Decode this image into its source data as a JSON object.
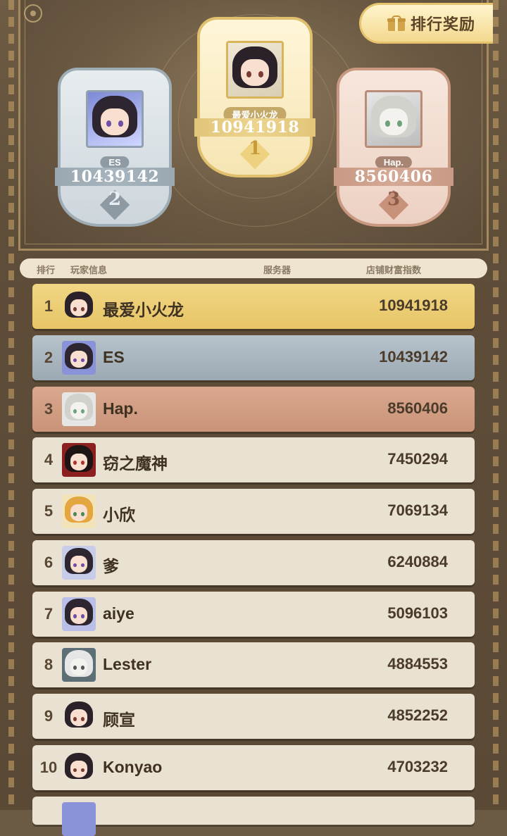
{
  "reward_button": {
    "label": "排行奖励",
    "icon": "gift-icon"
  },
  "podium": [
    {
      "rank": "2",
      "name": "ES",
      "score": "10439142",
      "medal": "silver"
    },
    {
      "rank": "1",
      "name": "最爱小火龙",
      "score": "10941918",
      "medal": "gold"
    },
    {
      "rank": "3",
      "name": "Hap.",
      "score": "8560406",
      "medal": "bronze"
    }
  ],
  "table_header": {
    "rank": "排行",
    "player": "玩家信息",
    "server": "服务器",
    "wealth": "店铺财富指数"
  },
  "rows": [
    {
      "rank": "1",
      "name": "最爱小火龙",
      "score": "10941918"
    },
    {
      "rank": "2",
      "name": "ES",
      "score": "10439142"
    },
    {
      "rank": "3",
      "name": "Hap.",
      "score": "8560406"
    },
    {
      "rank": "4",
      "name": "窃之魔神",
      "score": "7450294"
    },
    {
      "rank": "5",
      "name": "小欣",
      "score": "7069134"
    },
    {
      "rank": "6",
      "name": "爹",
      "score": "6240884"
    },
    {
      "rank": "7",
      "name": "aiye",
      "score": "5096103"
    },
    {
      "rank": "8",
      "name": "Lester",
      "score": "4884553"
    },
    {
      "rank": "9",
      "name": "顾宣",
      "score": "4852252"
    },
    {
      "rank": "10",
      "name": "Konyao",
      "score": "4703232"
    }
  ],
  "colors": {
    "gold": "#e7c566",
    "silver": "#9ba9b3",
    "bronze": "#c99378",
    "row_bg": "#e9e1d1",
    "panel_bg": "#5e4d38"
  }
}
